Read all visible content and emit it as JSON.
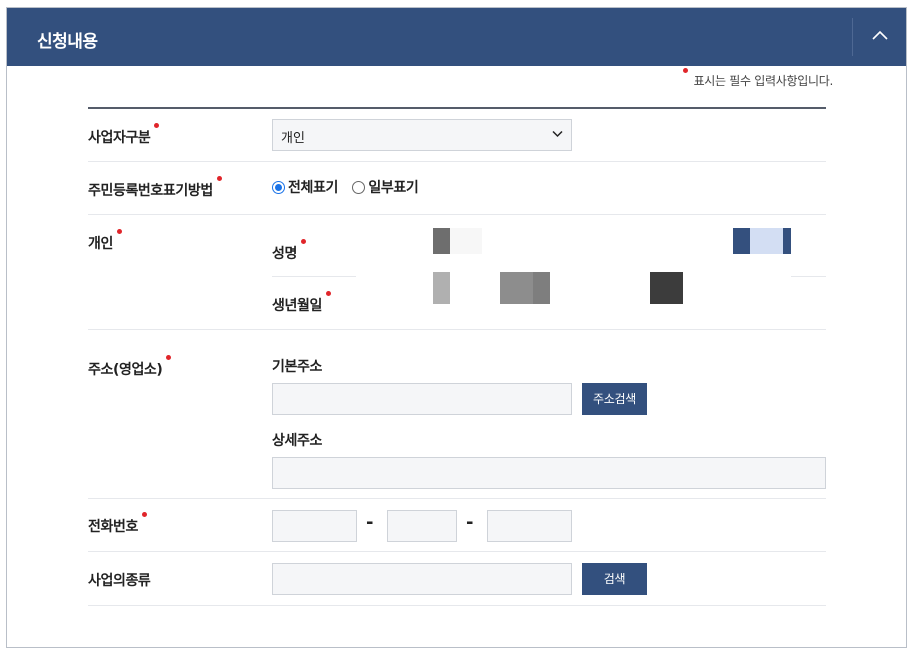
{
  "panel": {
    "title": "신청내용",
    "required_note": "표시는 필수 입력사항입니다."
  },
  "fields": {
    "business_type": {
      "label": "사업자구분",
      "value": "개인"
    },
    "id_display_method": {
      "label": "주민등록번호표기방법",
      "options": [
        "전체표기",
        "일부표기"
      ],
      "selected": "전체표기"
    },
    "individual": {
      "label": "개인",
      "name_label": "성명",
      "birth_label": "생년월일"
    },
    "address": {
      "label": "주소(영업소)",
      "basic_label": "기본주소",
      "detail_label": "상세주소",
      "search_button": "주소검색"
    },
    "phone": {
      "label": "전화번호",
      "separator": "-"
    },
    "business_kind": {
      "label": "사업의종류",
      "search_button": "검색"
    }
  },
  "colors": {
    "header_bg": "#33507e",
    "required_dot": "#e0252a",
    "button_bg": "#33507e"
  }
}
